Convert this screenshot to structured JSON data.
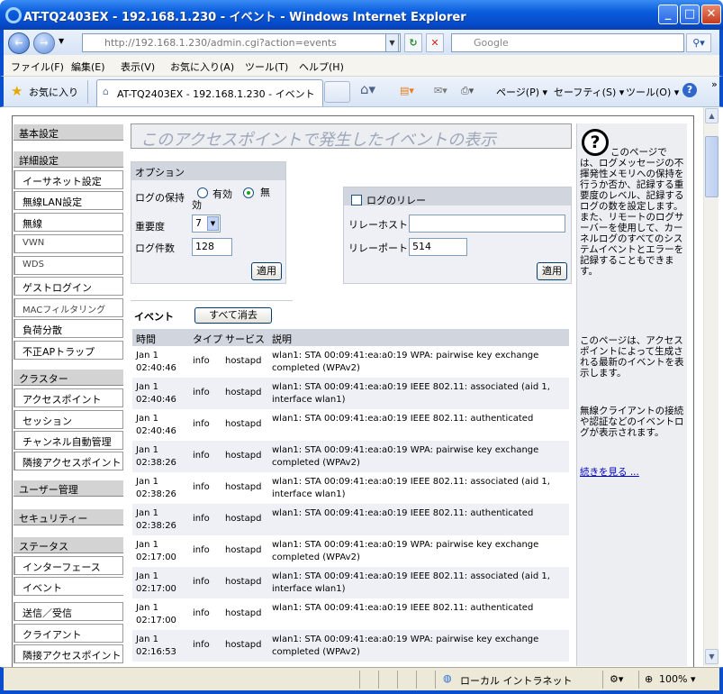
{
  "window": {
    "title": "AT-TQ2403EX - 192.168.1.230 - イベント - Windows Internet Explorer"
  },
  "addressbar": {
    "url_host": "http://192.168.1.230/",
    "url_path": "admin.cgi?action=events",
    "search_placeholder": "Google"
  },
  "menubar": [
    "ファイル(F)",
    "編集(E)",
    "表示(V)",
    "お気に入り(A)",
    "ツール(T)",
    "ヘルプ(H)"
  ],
  "favorites": {
    "label": "お気に入り",
    "tab_title": "AT-TQ2403EX - 192.168.1.230 - イベント",
    "page_menu": "ページ(P)",
    "safety_menu": "セーフティ(S)",
    "tools_menu": "ツール(O)"
  },
  "nav": {
    "basic": "基本設定",
    "advanced": "詳細設定",
    "advanced_items": [
      "イーサネット設定",
      "無線LAN設定",
      "無線",
      "VWN",
      "WDS",
      "ゲストログイン",
      "MACフィルタリング",
      "負荷分散",
      "不正APトラップ"
    ],
    "cluster": "クラスター",
    "cluster_items": [
      "アクセスポイント",
      "セッション",
      "チャンネル自動管理",
      "隣接アクセスポイント"
    ],
    "user_mgmt": "ユーザー管理",
    "security": "セキュリティー",
    "status": "ステータス",
    "status_items": [
      "インターフェース",
      "イベント",
      "送信／受信",
      "クライアント",
      "隣接アクセスポイント"
    ]
  },
  "page": {
    "title": "このアクセスポイントで発生したイベントの表示"
  },
  "options": {
    "heading": "オプション",
    "log_persist_label": "ログの保持",
    "enable_label": "有効",
    "disable_label": "無効",
    "severity_label": "重要度",
    "severity_value": "7",
    "count_label": "ログ件数",
    "count_value": "128",
    "apply": "適用"
  },
  "relay": {
    "heading": "ログのリレー",
    "host_label": "リレーホスト",
    "host_value": "",
    "port_label": "リレーポート",
    "port_value": "514",
    "apply": "適用"
  },
  "events": {
    "heading": "イベント",
    "clear_all": "すべて消去",
    "columns": [
      "時間",
      "タイプ",
      "サービス",
      "説明"
    ],
    "rows": [
      {
        "date": "Jan 1",
        "time": "02:40:46",
        "type": "info",
        "service": "hostapd",
        "desc": "wlan1: STA 00:09:41:ea:a0:19 WPA: pairwise key exchange completed (WPAv2)"
      },
      {
        "date": "Jan 1",
        "time": "02:40:46",
        "type": "info",
        "service": "hostapd",
        "desc": "wlan1: STA 00:09:41:ea:a0:19 IEEE 802.11: associated (aid 1, interface wlan1)"
      },
      {
        "date": "Jan 1",
        "time": "02:40:46",
        "type": "info",
        "service": "hostapd",
        "desc": "wlan1: STA 00:09:41:ea:a0:19 IEEE 802.11: authenticated"
      },
      {
        "date": "Jan 1",
        "time": "02:38:26",
        "type": "info",
        "service": "hostapd",
        "desc": "wlan1: STA 00:09:41:ea:a0:19 WPA: pairwise key exchange completed (WPAv2)"
      },
      {
        "date": "Jan 1",
        "time": "02:38:26",
        "type": "info",
        "service": "hostapd",
        "desc": "wlan1: STA 00:09:41:ea:a0:19 IEEE 802.11: associated (aid 1, interface wlan1)"
      },
      {
        "date": "Jan 1",
        "time": "02:38:26",
        "type": "info",
        "service": "hostapd",
        "desc": "wlan1: STA 00:09:41:ea:a0:19 IEEE 802.11: authenticated"
      },
      {
        "date": "Jan 1",
        "time": "02:17:00",
        "type": "info",
        "service": "hostapd",
        "desc": "wlan1: STA 00:09:41:ea:a0:19 WPA: pairwise key exchange completed (WPAv2)"
      },
      {
        "date": "Jan 1",
        "time": "02:17:00",
        "type": "info",
        "service": "hostapd",
        "desc": "wlan1: STA 00:09:41:ea:a0:19 IEEE 802.11: associated (aid 1, interface wlan1)"
      },
      {
        "date": "Jan 1",
        "time": "02:17:00",
        "type": "info",
        "service": "hostapd",
        "desc": "wlan1: STA 00:09:41:ea:a0:19 IEEE 802.11: authenticated"
      },
      {
        "date": "Jan 1",
        "time": "02:16:53",
        "type": "info",
        "service": "hostapd",
        "desc": "wlan1: STA 00:09:41:ea:a0:19 WPA: pairwise key exchange completed (WPAv2)"
      }
    ]
  },
  "help": {
    "p1": "このページでは、ログメッセージの不揮発性メモリへの保持を行うか否か、記録する重要度のレベル、記録するログの数を設定します。また、リモートのログサーバーを使用して、カーネルログのすべてのシステムイベントとエラーを記録することもできます。",
    "p2": "このページは、アクセスポイントによって生成される最新のイベントを表示します。",
    "p3": "無線クライアントの接続や認証などのイベントログが表示されます。",
    "more": "続きを見る ..."
  },
  "statusbar": {
    "zone": "ローカル イントラネット",
    "zoom": "100%"
  },
  "colors": {
    "titlebar": "#0a5ddc",
    "panel": "#eef0f5",
    "panel_head": "#d0d5de",
    "link": "#0000cc"
  }
}
